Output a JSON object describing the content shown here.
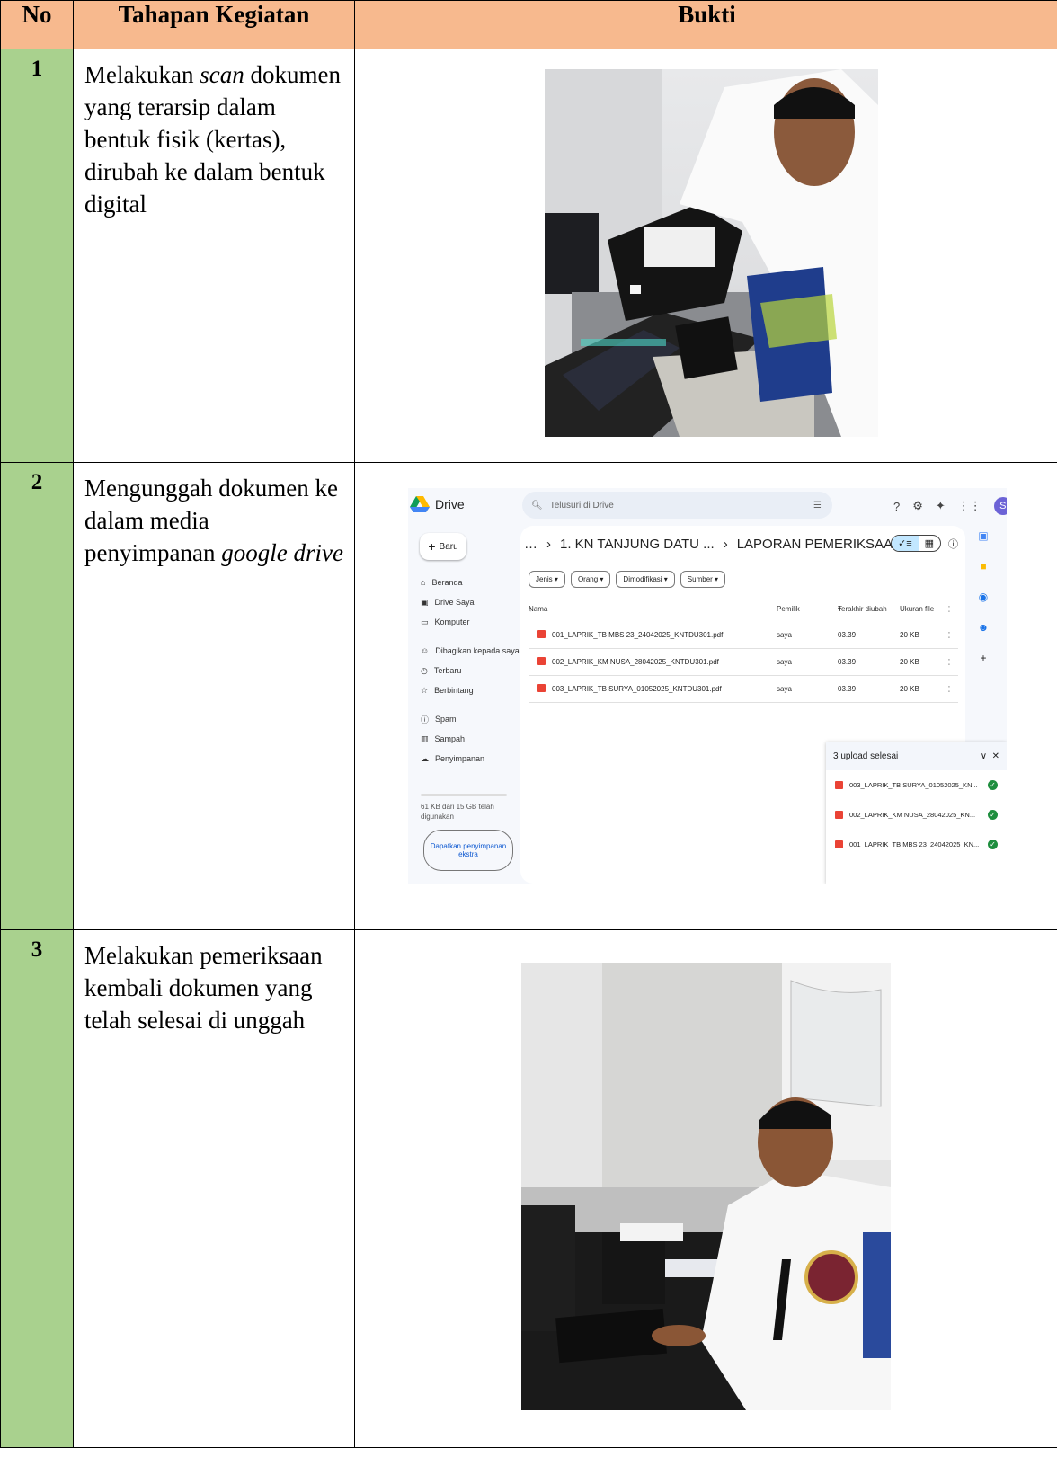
{
  "header": {
    "no": "No",
    "stage": "Tahapan Kegiatan",
    "evidence": "Bukti"
  },
  "rows": [
    {
      "no": "1",
      "text_a": "Melakukan ",
      "text_em": "scan",
      "text_b": " dokumen yang terarsip dalam bentuk fisik (kertas), dirubah ke dalam bentuk digital"
    },
    {
      "no": "2",
      "text_a": "Mengunggah dokumen ke dalam media penyimpanan ",
      "text_em": "google drive",
      "text_b": ""
    },
    {
      "no": "3",
      "text_a": "Melakukan pemeriksaan kembali dokumen yang telah selesai di unggah",
      "text_em": "",
      "text_b": ""
    }
  ],
  "drive": {
    "app_name": "Drive",
    "search_placeholder": "Telusuri di Drive",
    "avatar": "S",
    "new_label": "Baru",
    "nav": [
      "Beranda",
      "Drive Saya",
      "Komputer",
      "Dibagikan kepada saya",
      "Terbaru",
      "Berbintang",
      "Spam",
      "Sampah",
      "Penyimpanan"
    ],
    "storage_text": "61 KB dari 15 GB telah digunakan",
    "extra_storage": "Dapatkan penyimpanan ekstra",
    "breadcrumb_1": "1. KN TANJUNG DATU ...",
    "breadcrumb_2": "LAPORAN PEMERIKSAAN",
    "filters": [
      "Jenis",
      "Orang",
      "Dimodifikasi",
      "Sumber"
    ],
    "columns": {
      "name": "Nama",
      "owner": "Pemilik",
      "modified": "Terakhir diubah",
      "size": "Ukuran file"
    },
    "files": [
      {
        "name": "001_LAPRIK_TB MBS 23_24042025_KNTDU301.pdf",
        "owner": "saya",
        "modified": "03.39",
        "size": "20 KB"
      },
      {
        "name": "002_LAPRIK_KM NUSA_28042025_KNTDU301.pdf",
        "owner": "saya",
        "modified": "03.39",
        "size": "20 KB"
      },
      {
        "name": "003_LAPRIK_TB SURYA_01052025_KNTDU301.pdf",
        "owner": "saya",
        "modified": "03.39",
        "size": "20 KB"
      }
    ],
    "upload_title": "3 upload selesai",
    "uploads": [
      "003_LAPRIK_TB SURYA_01052025_KN...",
      "002_LAPRIK_KM NUSA_28042025_KN...",
      "001_LAPRIK_TB MBS 23_24042025_KN..."
    ]
  },
  "colors": {
    "header_bg": "#f7b98e",
    "number_col_bg": "#a9d18e",
    "drive_blue": "#0b57d0",
    "pdf_red": "#ea4335"
  }
}
